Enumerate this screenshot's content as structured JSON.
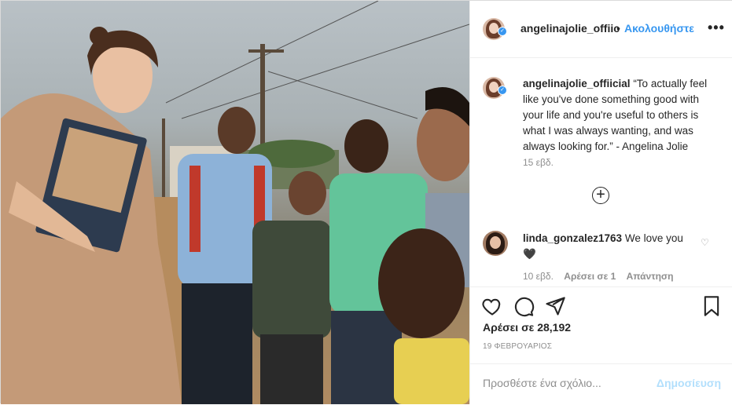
{
  "post": {
    "photo_icon": "post-photo",
    "header": {
      "username": "angelinajolie_offiic",
      "separator": "•",
      "follow_label": "Ακολουθήστε",
      "more_icon": "more-options-icon"
    },
    "caption": {
      "username": "angelinajolie_offiicial",
      "text": "“To actually feel like you've done something good with your life and you're useful to others is what I was always wanting, and was always looking for.” - Angelina Jolie",
      "age": "15 εβδ."
    },
    "load_more_icon": "plus-circle-icon",
    "comments": [
      {
        "username": "linda_gonzalez1763",
        "text": "We love you",
        "emoji": "🖤",
        "age": "10 εβδ.",
        "likes": "Αρέσει σε 1",
        "reply": "Απάντηση"
      }
    ],
    "actions": {
      "like_icon": "heart-icon",
      "comment_icon": "comment-icon",
      "share_icon": "share-icon",
      "save_icon": "bookmark-icon"
    },
    "likes_text": "Αρέσει σε 28,192",
    "date": "19 ΦΕΒΡΟΥΑΡΙΟΣ",
    "add_comment": {
      "placeholder": "Προσθέστε ένα σχόλιο...",
      "post_label": "Δημοσίευση"
    }
  },
  "colors": {
    "link_blue": "#3897f0",
    "post_disabled": "#b2dffc",
    "muted": "#8e8e8e"
  }
}
